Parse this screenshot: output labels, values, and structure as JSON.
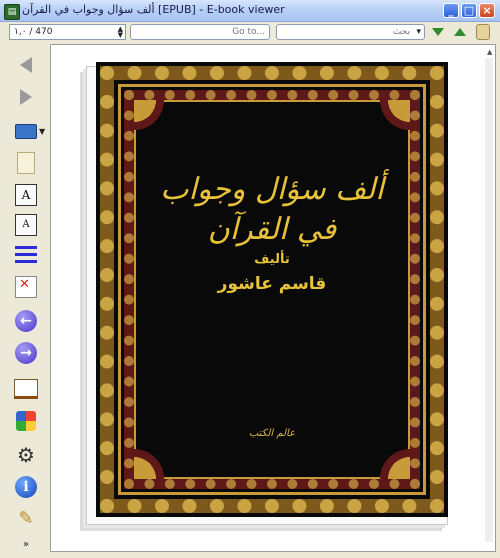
{
  "window": {
    "title": "ألف سؤال وجواب في القرآن [EPUB] - E-book viewer"
  },
  "toolbar": {
    "page_position": "١,٠ / 470",
    "goto_placeholder": "Go to...",
    "search_placeholder": "بحث"
  },
  "icons": {
    "back": "back-arrow-icon",
    "forward": "forward-arrow-icon",
    "toc": "laptop-icon",
    "bookmark": "document-icon",
    "font_larger": "font-larger-icon",
    "font_smaller": "font-smaller-icon",
    "reference": "lines-icon",
    "fullscreen": "fullscreen-icon",
    "previous_page": "previous-circle-icon",
    "next_page": "next-circle-icon",
    "open_book": "open-book-icon",
    "preferences": "preferences-icon",
    "settings": "gear-icon",
    "about": "info-icon",
    "tools": "magic-wand-icon"
  },
  "tools": {
    "font_larger_glyph": "A",
    "font_smaller_glyph": "A",
    "prev_glyph": "←",
    "next_glyph": "→",
    "info_glyph": "i",
    "more_glyph": "»"
  },
  "book": {
    "title": "ألف سؤال وجواب في القرآن",
    "author_label": "تأليف",
    "author": "قاسم عاشور",
    "publisher": "عالم الكتب"
  },
  "colors": {
    "cover_background": "#090909",
    "gold": "#e8c33a",
    "frame_red": "#5e1818"
  }
}
